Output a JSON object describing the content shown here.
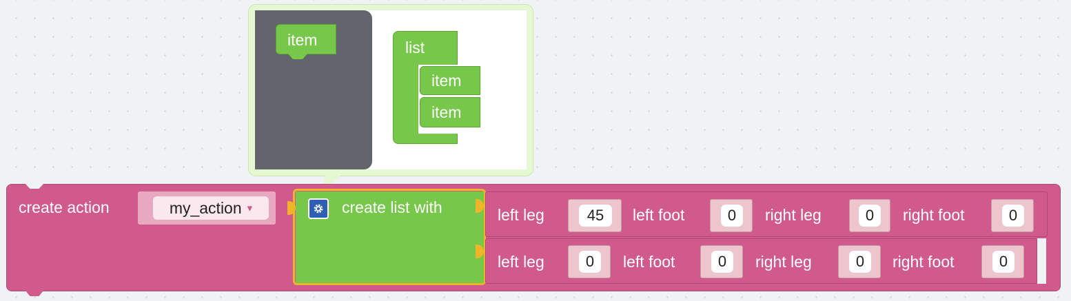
{
  "mutator": {
    "flyout_item_label": "item",
    "container_label": "list",
    "items": [
      {
        "label": "item"
      },
      {
        "label": "item"
      }
    ]
  },
  "action_block": {
    "label": "create action",
    "dropdown_value": "my_action",
    "dropdown_arrow": "▾"
  },
  "list_block": {
    "label": "create list with",
    "gear_icon": "gear-icon"
  },
  "rows": [
    {
      "fields": [
        {
          "label": "left leg",
          "value": "45"
        },
        {
          "label": "left foot",
          "value": "0"
        },
        {
          "label": "right leg",
          "value": "0"
        },
        {
          "label": "right foot",
          "value": "0"
        }
      ]
    },
    {
      "fields": [
        {
          "label": "left leg",
          "value": "0"
        },
        {
          "label": "left foot",
          "value": "0"
        },
        {
          "label": "right leg",
          "value": "0"
        },
        {
          "label": "right foot",
          "value": "0"
        }
      ]
    }
  ],
  "colors": {
    "workspace": "#eff3f5",
    "action_block": "#d05a8c",
    "list_block": "#77c74a",
    "flyout": "#62666c",
    "selection_highlight": "#f0b429"
  }
}
